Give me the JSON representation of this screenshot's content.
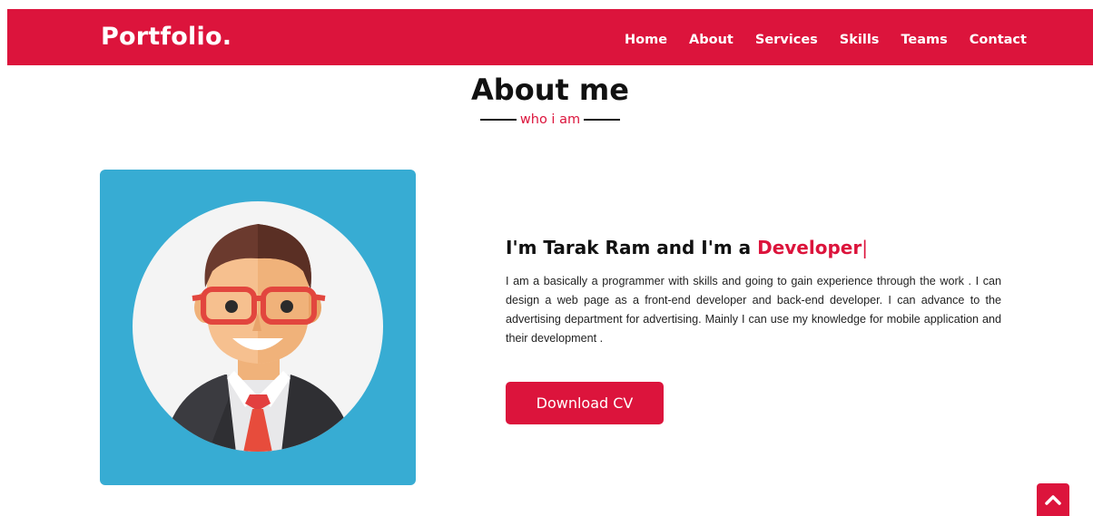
{
  "navbar": {
    "logo": "Portfolio.",
    "menu": [
      {
        "label": "Home"
      },
      {
        "label": "About"
      },
      {
        "label": "Services"
      },
      {
        "label": "Skills"
      },
      {
        "label": "Teams"
      },
      {
        "label": "Contact"
      }
    ]
  },
  "about": {
    "title": "About me",
    "subtitle": "who i am",
    "heading_prefix": "I'm Tarak Ram and I'm a ",
    "heading_role": "Developer",
    "heading_cursor": "|",
    "description": "I am a basically a programmer with skills and going to gain experience through the work . I can design a web page as a front-end developer and back-end developer. I can advance to the advertising department for advertising. Mainly I can use my knowledge for mobile application and their development .",
    "button_label": "Download CV"
  },
  "icons": {
    "scroll_top": "chevron-up-icon",
    "avatar": "developer-avatar"
  },
  "colors": {
    "accent": "#dc143c",
    "avatar_bg": "#37acd3"
  }
}
